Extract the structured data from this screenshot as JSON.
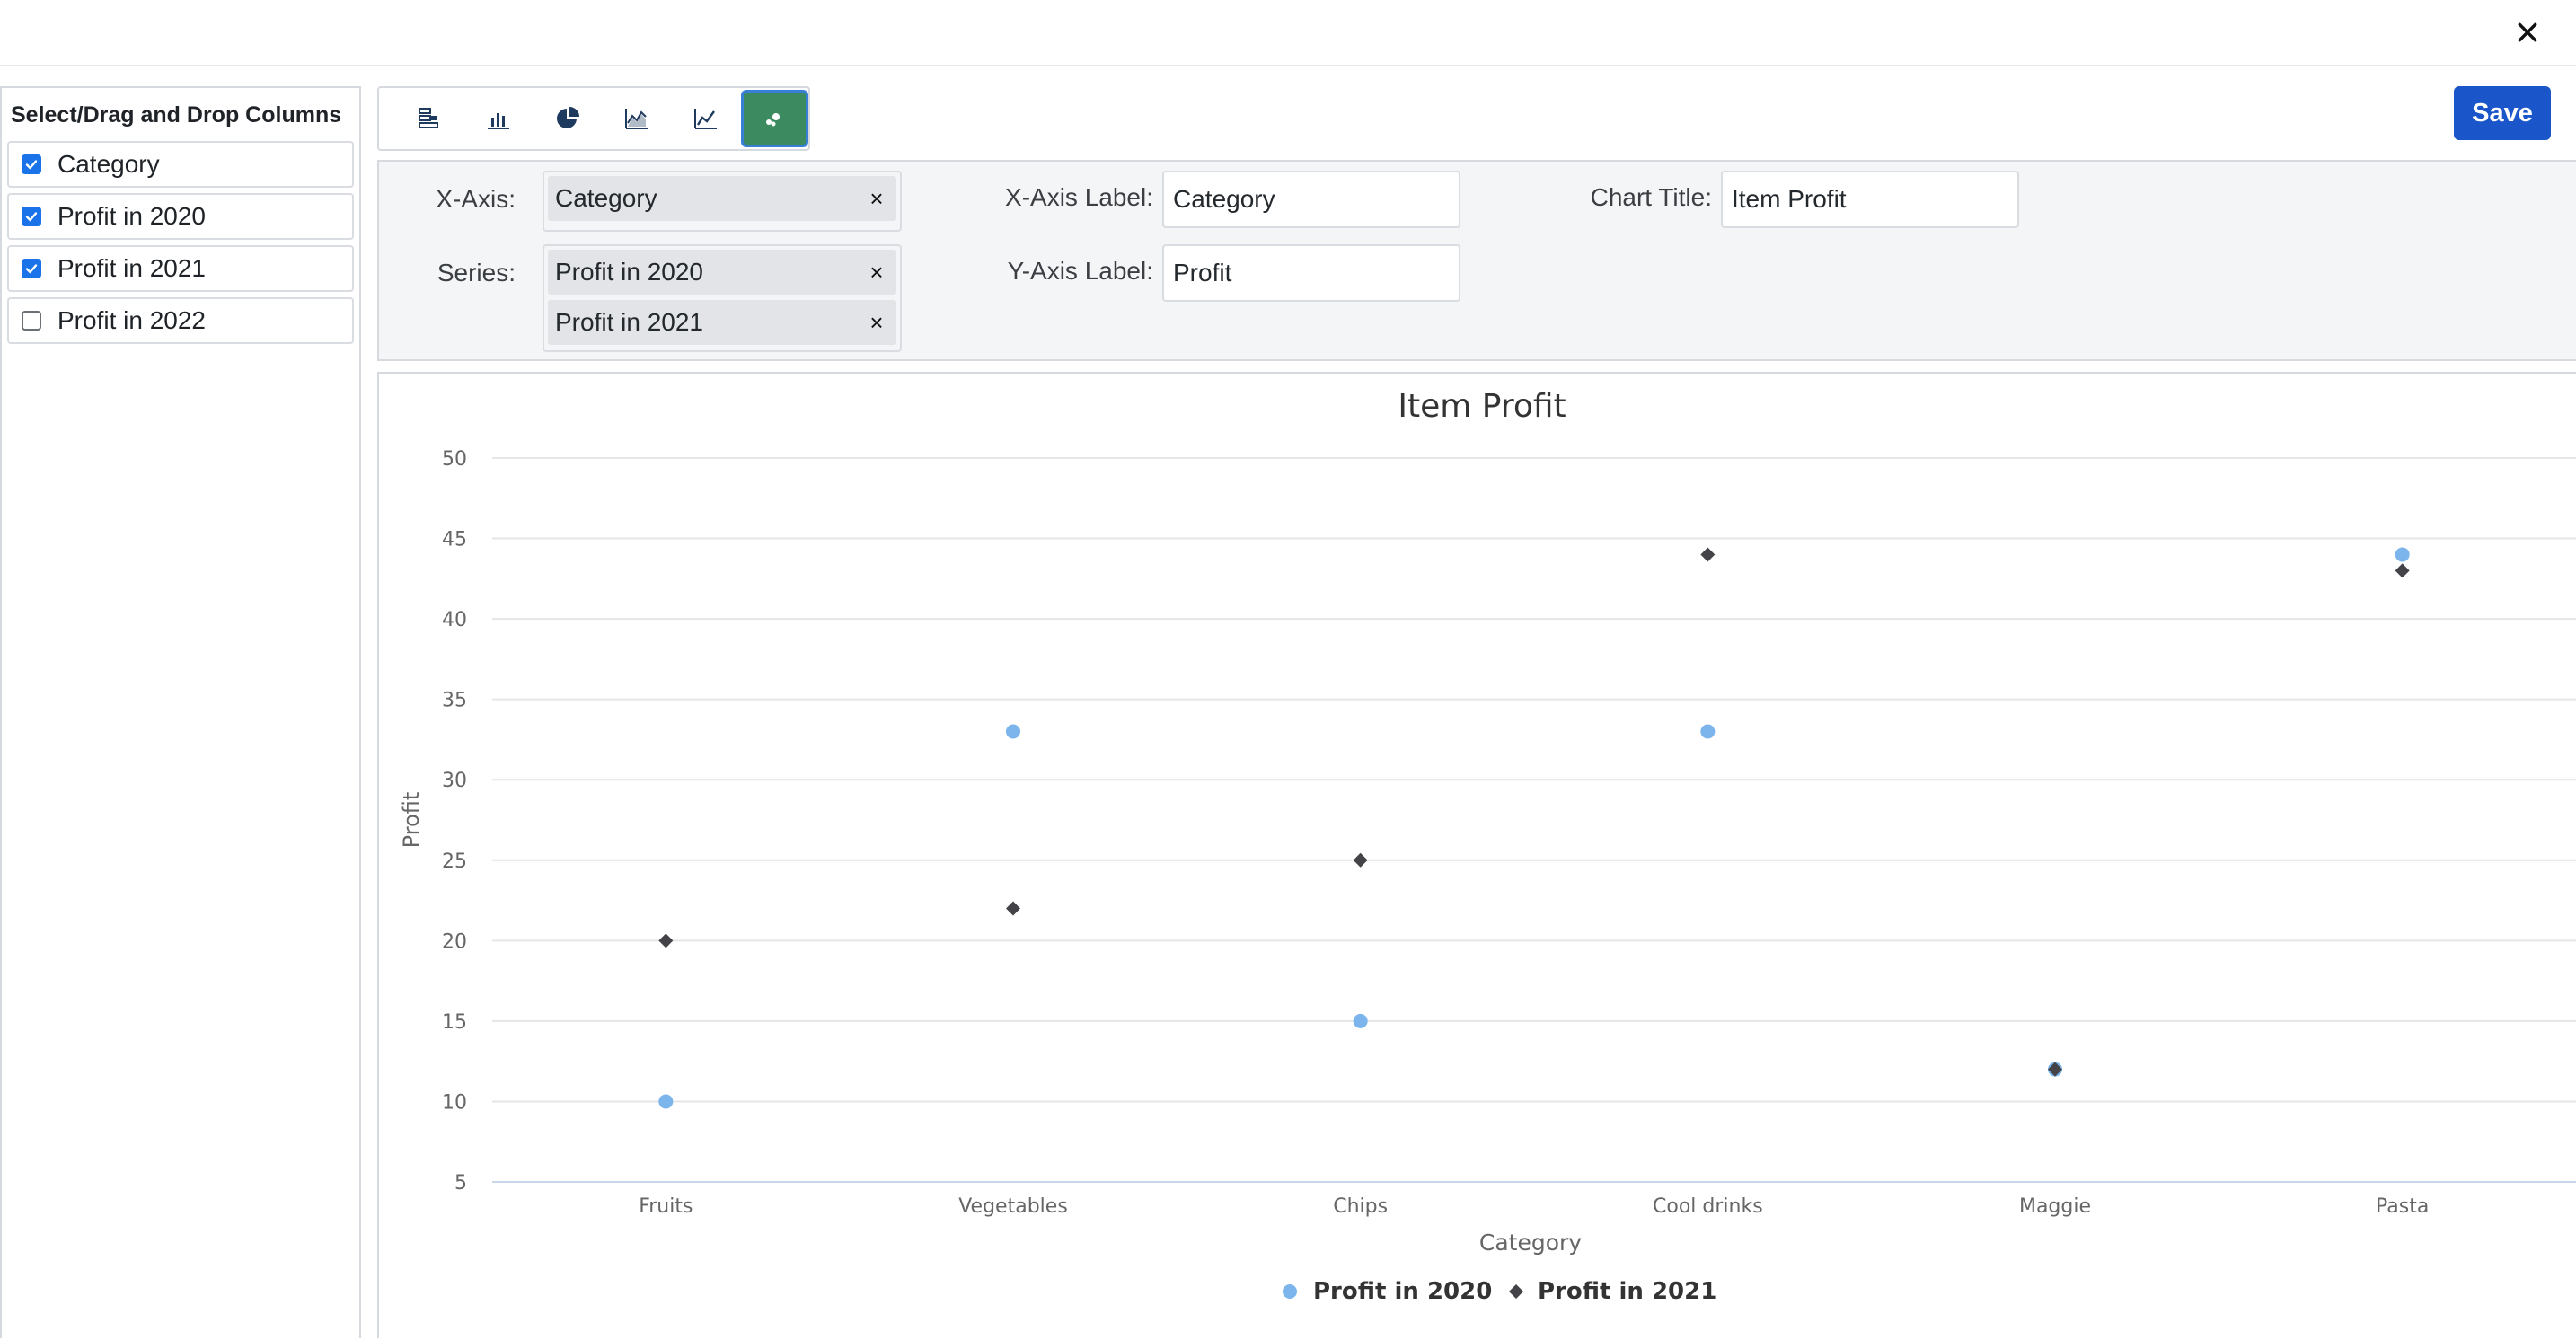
{
  "left_panel": {
    "title": "Select/Drag and Drop Columns",
    "columns": [
      {
        "label": "Category",
        "checked": true
      },
      {
        "label": "Profit in 2020",
        "checked": true
      },
      {
        "label": "Profit in 2021",
        "checked": true
      },
      {
        "label": "Profit in 2022",
        "checked": false
      }
    ]
  },
  "toolbar": {
    "buttons": [
      {
        "icon": "table-chart-icon",
        "active": false
      },
      {
        "icon": "bar-chart-icon",
        "active": false
      },
      {
        "icon": "pie-chart-icon",
        "active": false
      },
      {
        "icon": "area-chart-icon",
        "active": false
      },
      {
        "icon": "line-chart-icon",
        "active": false
      },
      {
        "icon": "scatter-chart-icon",
        "active": true
      }
    ],
    "save_label": "Save"
  },
  "config": {
    "x_axis_label_text": "X-Axis:",
    "series_label_text": "Series:",
    "x_axis_value": "Category",
    "series_values": [
      "Profit in 2020",
      "Profit in 2021"
    ],
    "x_axis_title_label": "X-Axis Label:",
    "x_axis_title_value": "Category",
    "y_axis_title_label": "Y-Axis Label:",
    "y_axis_title_value": "Profit",
    "chart_title_label": "Chart Title:",
    "chart_title_value": "Item Profit",
    "remove_glyph": "×"
  },
  "colors": {
    "series_2020": "#7cb5ec",
    "series_2021": "#434348",
    "active_button": "#3c8a5f",
    "save_button": "#1a56c9"
  },
  "chart_data": {
    "type": "scatter",
    "title": "Item Profit",
    "xlabel": "Category",
    "ylabel": "Profit",
    "categories": [
      "Fruits",
      "Vegetables",
      "Chips",
      "Cool drinks",
      "Maggie",
      "Pasta"
    ],
    "ylim": [
      5,
      50
    ],
    "yticks": [
      5,
      10,
      15,
      20,
      25,
      30,
      35,
      40,
      45,
      50
    ],
    "grid": true,
    "legend_position": "bottom-center",
    "series": [
      {
        "name": "Profit in 2020",
        "marker": "circle",
        "values": [
          10,
          33,
          15,
          33,
          12,
          44
        ]
      },
      {
        "name": "Profit in 2021",
        "marker": "diamond",
        "values": [
          20,
          22,
          25,
          44,
          12,
          43
        ]
      }
    ]
  }
}
